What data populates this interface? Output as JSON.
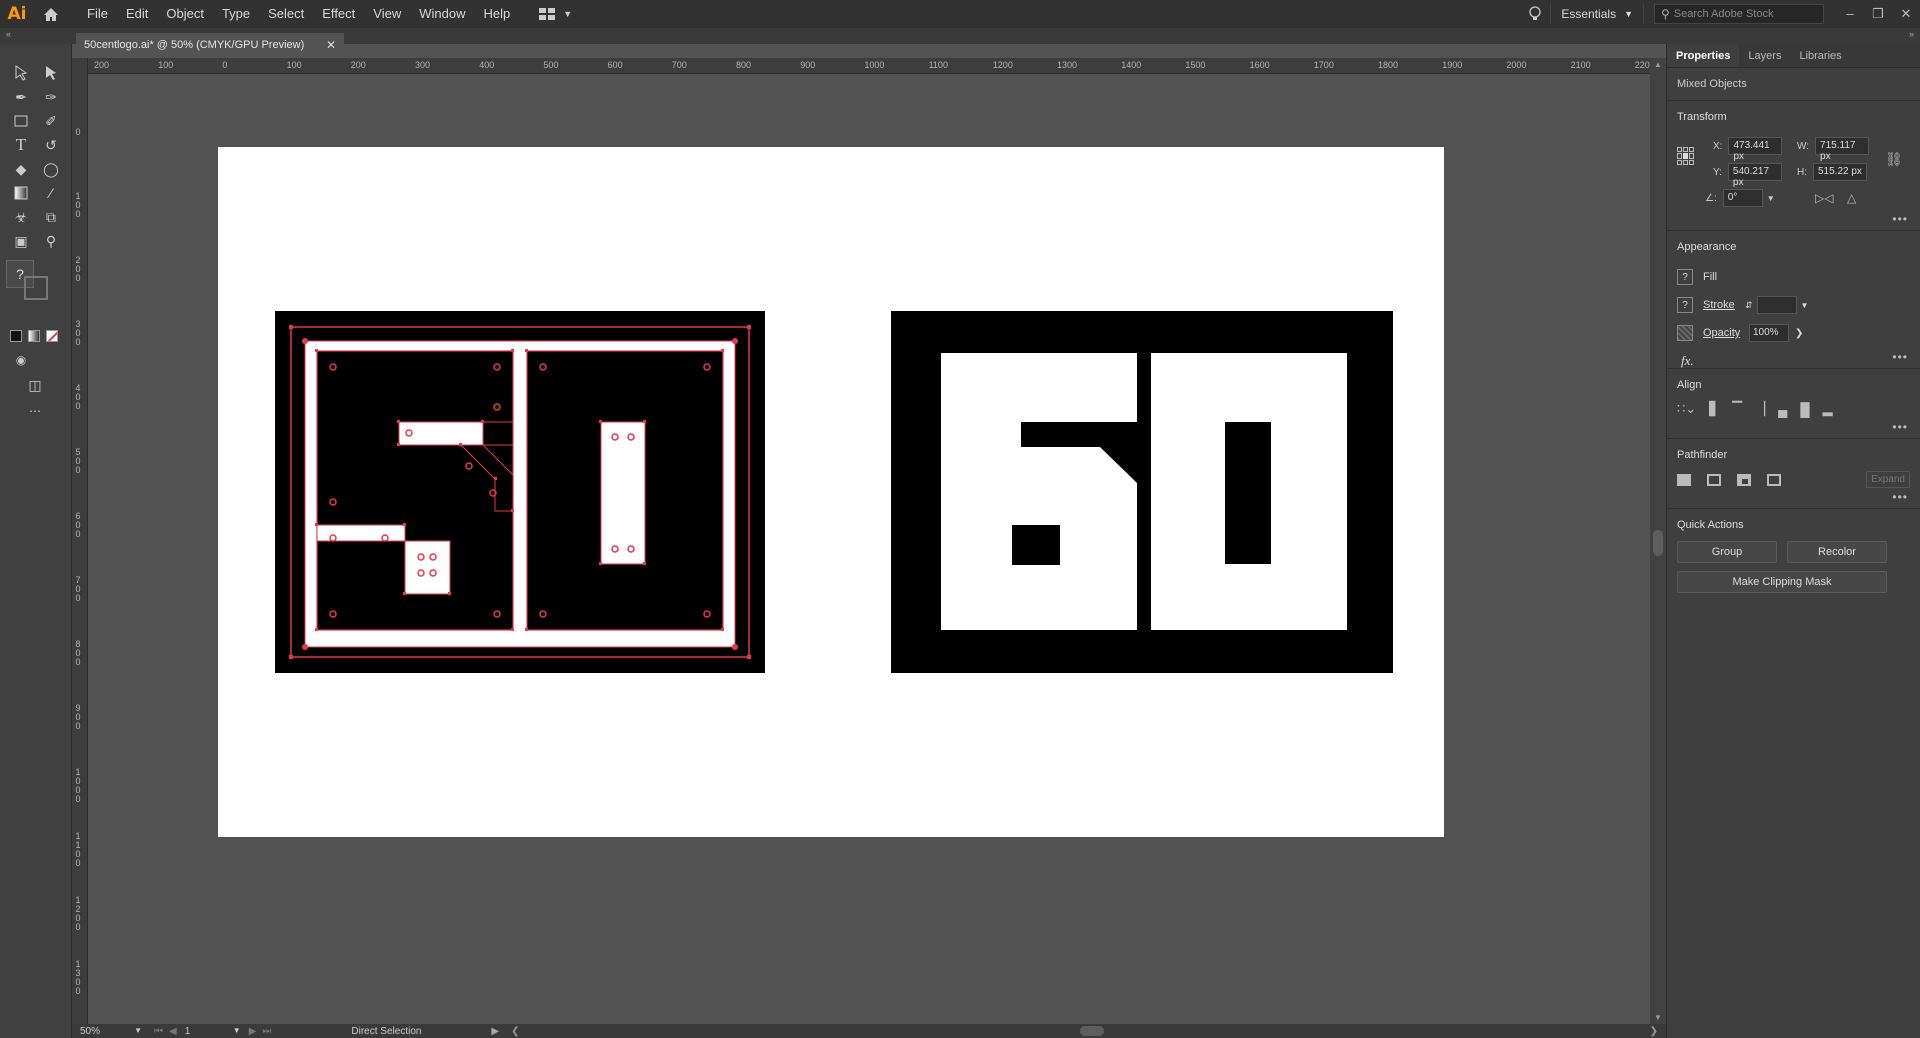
{
  "app": {
    "logo": "Ai",
    "menus": [
      "File",
      "Edit",
      "Object",
      "Type",
      "Select",
      "Effect",
      "View",
      "Window",
      "Help"
    ],
    "workspace": "Essentials",
    "search_placeholder": "Search Adobe Stock"
  },
  "document": {
    "tab_title": "50centlogo.ai* @ 50% (CMYK/GPU Preview)"
  },
  "ruler": {
    "h_labels": [
      "200",
      "100",
      "0",
      "100",
      "200",
      "300",
      "400",
      "500",
      "600",
      "700",
      "800",
      "900",
      "1000",
      "1100",
      "1200",
      "1300",
      "1400",
      "1500",
      "1600",
      "1700",
      "1800",
      "1900",
      "2000",
      "2100",
      "2200"
    ],
    "v_labels": [
      "0",
      "100",
      "200",
      "300",
      "400",
      "500",
      "600",
      "700",
      "800",
      "900",
      "1000",
      "1100",
      "1200",
      "1300"
    ]
  },
  "panel": {
    "tabs": [
      "Properties",
      "Layers",
      "Libraries"
    ],
    "selection": "Mixed Objects",
    "transform": {
      "title": "Transform",
      "x_label": "X:",
      "x": "473.441 px",
      "y_label": "Y:",
      "y": "540.217 px",
      "w_label": "W:",
      "w": "715.117 px",
      "h_label": "H:",
      "h": "515.22 px",
      "angle": "0°"
    },
    "appearance": {
      "title": "Appearance",
      "fill_label": "Fill",
      "stroke_label": "Stroke",
      "opacity_label": "Opacity",
      "opacity": "100%",
      "fx": "fx."
    },
    "align": {
      "title": "Align"
    },
    "pathfinder": {
      "title": "Pathfinder",
      "expand": "Expand"
    },
    "quick_actions": {
      "title": "Quick Actions",
      "group": "Group",
      "recolor": "Recolor",
      "clipping": "Make Clipping Mask"
    }
  },
  "status": {
    "zoom": "50%",
    "artboard": "1",
    "tool": "Direct Selection"
  },
  "colors": {
    "accent": "#ff9a00",
    "selection": "#e8374a"
  }
}
